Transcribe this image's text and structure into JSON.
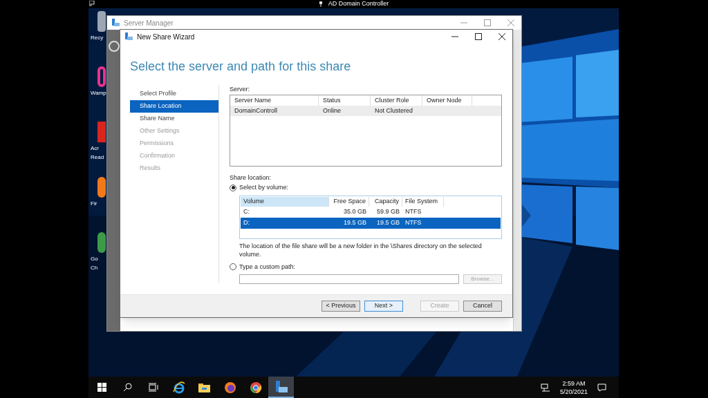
{
  "top_bar": {
    "title": "AD Domain Controller"
  },
  "desktop_icons": [
    {
      "kind": "recycle",
      "lines": [
        "Recy"
      ]
    },
    {
      "kind": "wamp",
      "lines": [
        "Wamp"
      ]
    },
    {
      "kind": "acrobat",
      "lines": [
        "Acr",
        "Read"
      ]
    },
    {
      "kind": "firefox",
      "lines": [
        "Fir"
      ]
    },
    {
      "kind": "chrome",
      "lines": [
        "Go",
        "Ch"
      ]
    }
  ],
  "server_manager": {
    "title": "Server Manager"
  },
  "wizard": {
    "title": "New Share Wizard",
    "heading": "Select the server and path for this share",
    "steps": [
      {
        "label": "Select Profile",
        "selected": false,
        "disabled": false
      },
      {
        "label": "Share Location",
        "selected": true,
        "disabled": false
      },
      {
        "label": "Share Name",
        "selected": false,
        "disabled": false
      },
      {
        "label": "Other Settings",
        "selected": false,
        "disabled": true
      },
      {
        "label": "Permissions",
        "selected": false,
        "disabled": true
      },
      {
        "label": "Confirmation",
        "selected": false,
        "disabled": true
      },
      {
        "label": "Results",
        "selected": false,
        "disabled": true
      }
    ],
    "server_label": "Server:",
    "server_table": {
      "columns": [
        "Server Name",
        "Status",
        "Cluster Role",
        "Owner Node"
      ],
      "rows": [
        {
          "cells": [
            "DomainControll",
            "Online",
            "Not Clustered",
            ""
          ],
          "selected": true
        }
      ]
    },
    "share_location_label": "Share location:",
    "options": [
      {
        "label": "Select by volume:",
        "selected": true
      },
      {
        "label": "Type a custom path:",
        "selected": false
      }
    ],
    "volume_table": {
      "columns": [
        "Volume",
        "Free Space",
        "Capacity",
        "File System"
      ],
      "rows": [
        {
          "cells": [
            "C:",
            "35.0 GB",
            "59.9 GB",
            "NTFS"
          ],
          "selected": false
        },
        {
          "cells": [
            "D:",
            "19.5 GB",
            "19.5 GB",
            "NTFS"
          ],
          "selected": true
        }
      ]
    },
    "description": "The location of the file share will be a new folder in the \\Shares directory on the selected volume.",
    "browse_button": {
      "label": "Browse...",
      "disabled": true
    },
    "buttons": [
      {
        "label": "< Previous",
        "disabled": false,
        "focused": false
      },
      {
        "label": "Next >",
        "disabled": false,
        "focused": true
      },
      {
        "label": "Create",
        "disabled": true,
        "focused": false
      },
      {
        "label": "Cancel",
        "disabled": false,
        "focused": false
      }
    ]
  },
  "taskbar": {
    "apps": [
      {
        "kind": "start",
        "active": false
      },
      {
        "kind": "search",
        "active": false
      },
      {
        "kind": "taskview",
        "active": false
      },
      {
        "kind": "ie",
        "active": false
      },
      {
        "kind": "explorer",
        "active": false
      },
      {
        "kind": "firefox",
        "active": false
      },
      {
        "kind": "chrome",
        "active": false
      },
      {
        "kind": "server",
        "active": true
      }
    ],
    "time": "2:59 AM",
    "date": "5/20/2021"
  }
}
